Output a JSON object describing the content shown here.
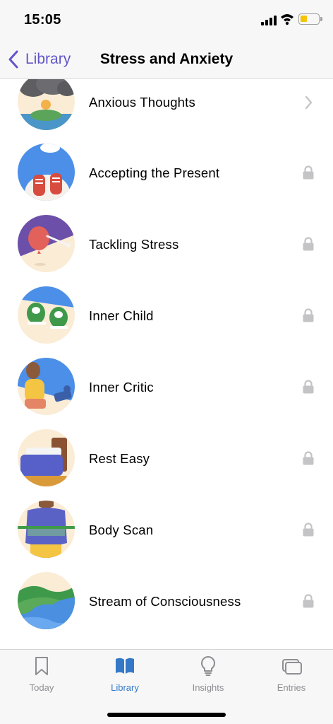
{
  "status_bar": {
    "time": "15:05",
    "battery_color": "#f5c400"
  },
  "nav": {
    "back_label": "Library",
    "title": "Stress and Anxiety",
    "accent": "#6156c9"
  },
  "list": {
    "items": [
      {
        "label": "Anxious Thoughts",
        "thumbnail": "storm-cloud-sun-illustration",
        "accessory": "chevron-right-icon",
        "locked": false
      },
      {
        "label": "Accepting the Present",
        "thumbnail": "sneakers-illustration",
        "accessory": "lock-icon",
        "locked": true
      },
      {
        "label": "Tackling Stress",
        "thumbnail": "balloon-pin-illustration",
        "accessory": "lock-icon",
        "locked": true
      },
      {
        "label": "Inner Child",
        "thumbnail": "green-shoes-illustration",
        "accessory": "lock-icon",
        "locked": true
      },
      {
        "label": "Inner Critic",
        "thumbnail": "person-sitting-illustration",
        "accessory": "lock-icon",
        "locked": true
      },
      {
        "label": "Rest Easy",
        "thumbnail": "bed-illustration",
        "accessory": "lock-icon",
        "locked": true
      },
      {
        "label": "Body Scan",
        "thumbnail": "body-scan-illustration",
        "accessory": "lock-icon",
        "locked": true
      },
      {
        "label": "Stream of Consciousness",
        "thumbnail": "river-landscape-illustration",
        "accessory": "lock-icon",
        "locked": true
      }
    ]
  },
  "tab_bar": {
    "active_color": "#3478c8",
    "tabs": [
      {
        "label": "Today",
        "icon": "bookmark-icon",
        "active": false
      },
      {
        "label": "Library",
        "icon": "open-book-icon",
        "active": true
      },
      {
        "label": "Insights",
        "icon": "lightbulb-icon",
        "active": false
      },
      {
        "label": "Entries",
        "icon": "cards-icon",
        "active": false
      }
    ]
  }
}
